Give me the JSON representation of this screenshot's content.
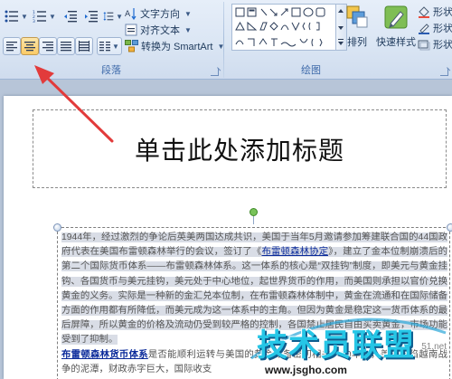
{
  "ribbon": {
    "paragraph_group": {
      "label": "段落",
      "text_direction_label": "文字方向",
      "align_text_label": "对齐文本",
      "smartart_label": "转换为 SmartArt"
    },
    "drawing_group": {
      "label": "绘图",
      "arrange_label": "排列",
      "quick_styles_label": "快速样式",
      "shape_fill_label": "形状",
      "shape_outline_label": "形状",
      "shape_effects_label": "形状"
    }
  },
  "slide": {
    "title": "单击此处添加标题",
    "body": {
      "para1": "1944年，经过激烈的争论后英美两国达成共识，美国于当年5月邀请参加筹建联合国的44国政府代表在美国布雷顿森林举行的会议，签订了《",
      "link1": "布雷顿森林协定",
      "para1b": "》，建立了金本位制崩溃后的第二个国际货币体系——布雷顿森林体系。这一体系的核心是“双挂钩”制度，即美元与黄金挂钩、各国货币与美元挂钩，美元处于中心地位，起世界货币的作用，而美国则承担以官价兑换黄金的义务。实际是一种新的金汇兑本位制，在布雷顿森林体制中，黄金在流通和在国际储备方面的作用都有所降低，而美元成为这一体系中的主角。但因为黄金是稳定这一货币体系的最后屏障，所以黄金的价格及流动仍受到较严格的控制，各国禁止居民自由买卖黄金，市场功能受到了抑制。",
      "link2": "布雷顿森林货币体系",
      "para2": "是否能顺利运转与美国的黄金储备密切相关。60年代，美国深陷越南战争的泥潭，财政赤字巨大，国际收支"
    }
  },
  "watermark": {
    "title": "技术员联盟",
    "url": "www.jsgho.com",
    "side": "51.net"
  },
  "colors": {
    "ribbon_bg": "#dbe6f4",
    "group_label": "#3e6aaa",
    "active_button": "#fbcb67",
    "annotation_arrow": "#e23b3b",
    "link": "#0a2a9a"
  }
}
